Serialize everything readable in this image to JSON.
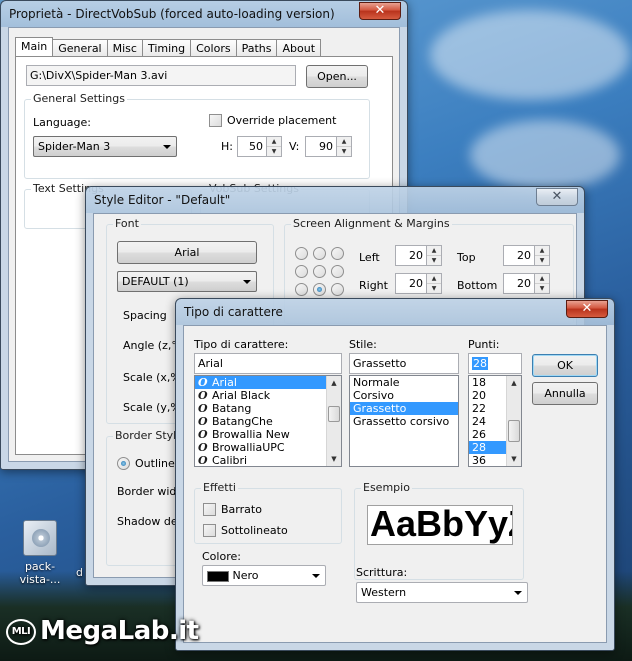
{
  "desktop": {
    "icon_label": "pack-vista-...",
    "icon2_label": "d",
    "watermark": "MegaLab.it",
    "watermark_badge": "MLI"
  },
  "props_window": {
    "title": "Proprietà - DirectVobSub (forced auto-loading version)",
    "tabs": [
      "Main",
      "General",
      "Misc",
      "Timing",
      "Colors",
      "Paths",
      "About"
    ],
    "active_tab": "Main",
    "file_path": "G:\\DivX\\Spider-Man 3.avi",
    "open_button": "Open...",
    "general_settings": "General Settings",
    "language_label": "Language:",
    "language_value": "Spider-Man 3",
    "override_label": "Override placement",
    "h_label": "H:",
    "h_value": "50",
    "v_label": "V:",
    "v_value": "90",
    "text_settings": "Text Settings",
    "vobsub_settings": "VobSub Settings"
  },
  "style_window": {
    "title": "Style Editor - \"Default\"",
    "font_group": "Font",
    "font_button": "Arial",
    "charset_value": "DEFAULT  (1)",
    "spacing_label": "Spacing",
    "angle_label": "Angle (z,°)",
    "scalex_label": "Scale (x,%",
    "scaley_label": "Scale (y,%",
    "border_group": "Border Style",
    "outline_label": "Outline",
    "border_width_label": "Border width",
    "shadow_label": "Shadow depth",
    "screen_group": "Screen Alignment & Margins",
    "left_label": "Left",
    "left_value": "20",
    "right_label": "Right",
    "right_value": "20",
    "top_label": "Top",
    "top_value": "20",
    "bottom_label": "Bottom",
    "bottom_value": "20"
  },
  "font_dialog": {
    "title": "Tipo di carattere",
    "font_label": "Tipo di carattere:",
    "font_value": "Arial",
    "fonts": [
      "Arial",
      "Arial Black",
      "Batang",
      "BatangChe",
      "Browallia New",
      "BrowalliaUPC",
      "Calibri"
    ],
    "selected_font": "Arial",
    "style_label": "Stile:",
    "style_value": "Grassetto",
    "styles": [
      "Normale",
      "Corsivo",
      "Grassetto",
      "Grassetto corsivo"
    ],
    "selected_style": "Grassetto",
    "size_label": "Punti:",
    "size_value": "28",
    "sizes": [
      "18",
      "20",
      "22",
      "24",
      "26",
      "28",
      "36"
    ],
    "selected_size": "28",
    "ok_button": "OK",
    "cancel_button": "Annulla",
    "effects_label": "Effetti",
    "strike_label": "Barrato",
    "underline_label": "Sottolineato",
    "color_label": "Colore:",
    "color_value": "Nero",
    "color_swatch": "#000000",
    "sample_label": "Esempio",
    "sample_text": "AaBbYyZz",
    "script_label": "Scrittura:",
    "script_value": "Western"
  },
  "colors": {
    "selection": "#3399ff",
    "close_red": "#c8412a"
  }
}
